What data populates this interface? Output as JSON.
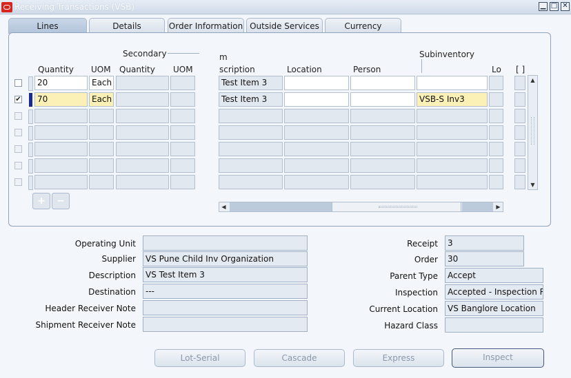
{
  "window": {
    "title": "Receiving Transactions (VSB)",
    "min": "▁",
    "max": "□",
    "close": "✕"
  },
  "tabs": [
    "Lines",
    "Details",
    "Order Information",
    "Outside Services",
    "Currency"
  ],
  "headers": {
    "secondary": "Secondary",
    "quantity": "Quantity",
    "uom": "UOM",
    "sec_quantity": "Quantity",
    "sec_uom": "UOM",
    "item_fragment": "m",
    "description": "scription",
    "location": "Location",
    "person": "Person",
    "subinventory": "Subinventory",
    "locator_fragment": "Lo",
    "folder_marker": "[ ]"
  },
  "rows": [
    {
      "checked": "",
      "quantity": "20",
      "uom": "Each",
      "description": "Test Item 3",
      "subinventory": ""
    },
    {
      "checked": "✔",
      "quantity": "70",
      "uom": "Each",
      "description": "Test Item 3",
      "subinventory": "VSB-S Inv3"
    }
  ],
  "detail": {
    "operating_unit": {
      "label": "Operating Unit",
      "value": ""
    },
    "supplier": {
      "label": "Supplier",
      "value": "VS Pune Child Inv Organization"
    },
    "description": {
      "label": "Description",
      "value": "VS Test Item 3"
    },
    "destination": {
      "label": "Destination",
      "value": "---"
    },
    "header_receiver_note": {
      "label": "Header Receiver Note",
      "value": ""
    },
    "shipment_receiver_note": {
      "label": "Shipment Receiver Note",
      "value": ""
    },
    "receipt": {
      "label": "Receipt",
      "value": "3"
    },
    "order": {
      "label": "Order",
      "value": "30"
    },
    "parent_type": {
      "label": "Parent Type",
      "value": "Accept"
    },
    "inspection": {
      "label": "Inspection",
      "value": "Accepted - Inspection R"
    },
    "current_location": {
      "label": "Current Location",
      "value": "VS Banglore Location"
    },
    "hazard_class": {
      "label": "Hazard Class",
      "value": ""
    }
  },
  "buttons": {
    "lot_serial": "Lot-Serial",
    "cascade": "Cascade",
    "express": "Express",
    "inspect": "Inspect"
  },
  "icons": {
    "add": "plus-icon",
    "remove": "minus-icon"
  },
  "colors": {
    "selected_row_indicator": "#1a2a8c",
    "required_field": "#fbf1b6"
  }
}
